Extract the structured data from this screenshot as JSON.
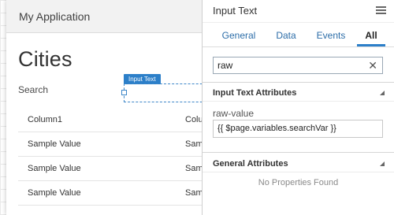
{
  "app": {
    "title": "My Application"
  },
  "page": {
    "title": "Cities",
    "search_label": "Search",
    "selected_component_tag": "Input Text"
  },
  "table": {
    "columns": [
      "Column1",
      "Colu"
    ],
    "rows": [
      [
        "Sample Value",
        "Sam"
      ],
      [
        "Sample Value",
        "Sam"
      ],
      [
        "Sample Value",
        "Sam"
      ]
    ]
  },
  "panel": {
    "title": "Input Text",
    "menu_icon": "hamburger-menu-icon",
    "tabs": [
      {
        "label": "General",
        "active": false
      },
      {
        "label": "Data",
        "active": false
      },
      {
        "label": "Events",
        "active": false
      },
      {
        "label": "All",
        "active": true
      }
    ],
    "filter": {
      "value": "raw",
      "clear_icon": "close-icon"
    },
    "sections": {
      "input_text_attributes": {
        "title": "Input Text Attributes",
        "attribute_label": "raw-value",
        "attribute_value": "{{ $page.variables.searchVar }}"
      },
      "general_attributes": {
        "title": "General Attributes",
        "empty_text": "No Properties Found"
      }
    }
  },
  "colors": {
    "accent": "#2c7fc9",
    "tab_text": "#2c6da8"
  }
}
